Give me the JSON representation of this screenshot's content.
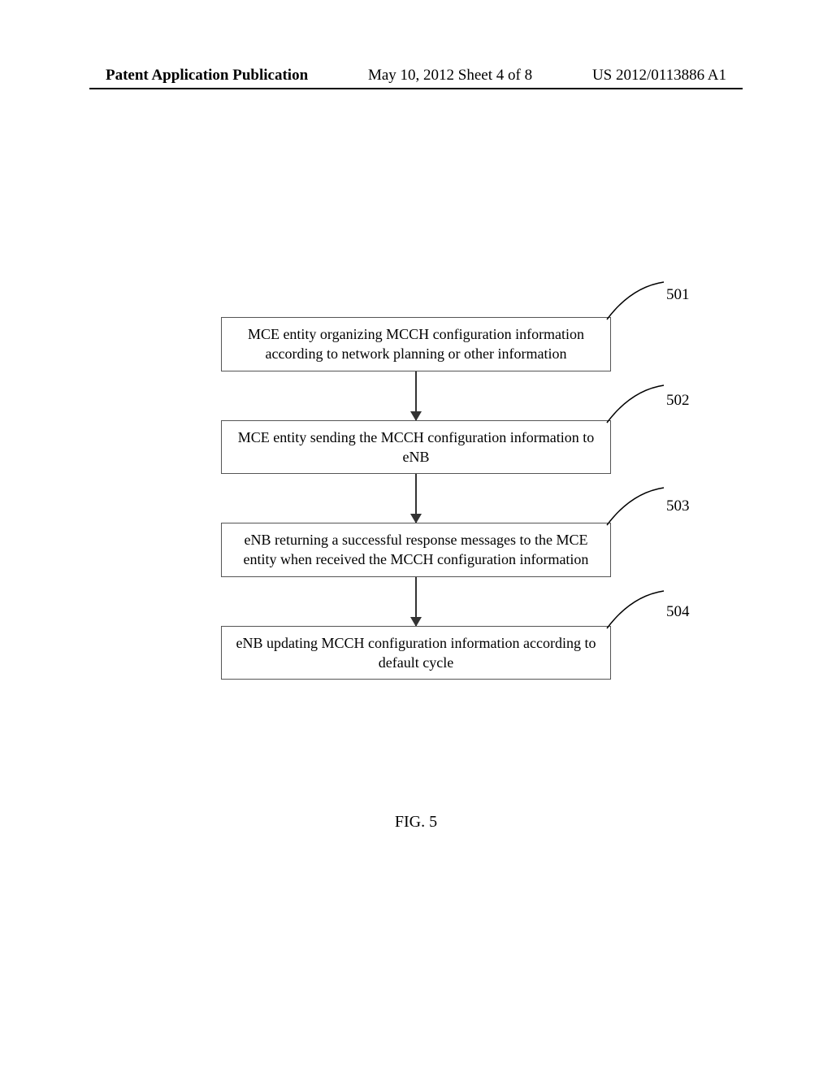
{
  "header": {
    "left": "Patent Application Publication",
    "center": "May 10, 2012  Sheet 4 of 8",
    "right": "US 2012/0113886 A1"
  },
  "steps": [
    {
      "num": "501",
      "text": "MCE entity organizing MCCH configuration information according to network planning or other information"
    },
    {
      "num": "502",
      "text": "MCE entity sending the MCCH configuration information to eNB"
    },
    {
      "num": "503",
      "text": "eNB returning a successful response messages to the MCE entity when received the MCCH configuration information"
    },
    {
      "num": "504",
      "text": "eNB updating MCCH configuration information according to default cycle"
    }
  ],
  "figure_caption": "FIG. 5"
}
